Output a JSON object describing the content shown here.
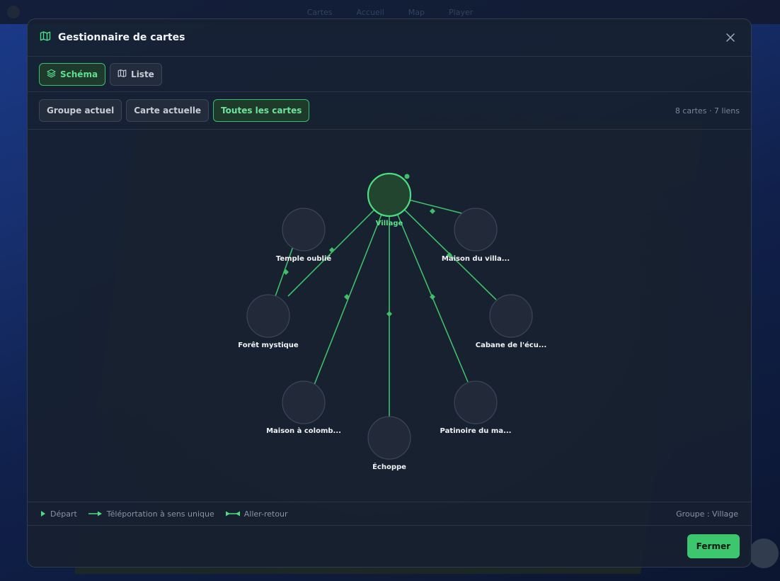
{
  "background": {
    "nav": [
      "Cartes",
      "Accueil",
      "Map",
      "Player"
    ]
  },
  "modal": {
    "title": "Gestionnaire de cartes",
    "title_icon": "map-icon",
    "close_icon": "close-icon",
    "view_tabs": [
      {
        "label": "Schéma",
        "icon": "layers-icon",
        "active": true
      },
      {
        "label": "Liste",
        "icon": "map-icon",
        "active": false
      }
    ],
    "filters": [
      {
        "label": "Groupe actuel",
        "active": false
      },
      {
        "label": "Carte actuelle",
        "active": false
      },
      {
        "label": "Toutes les cartes",
        "active": true
      }
    ],
    "stats": "8 cartes · 7 liens",
    "graph": {
      "root": "Village",
      "nodes": [
        "Village",
        "Temple oublié",
        "Maison du villa...",
        "Forêt mystique",
        "Cabane de l'écu...",
        "Maison à colomb...",
        "Échoppe",
        "Patinoire du ma..."
      ]
    },
    "legend": {
      "start": "Départ",
      "one_way": "Téléportation à sens unique",
      "two_way": "Aller-retour",
      "group": "Groupe : Village"
    },
    "footer": {
      "close_label": "Fermer"
    },
    "colors": {
      "accent": "#3cc76e",
      "node_fill": "#222a3a"
    }
  }
}
